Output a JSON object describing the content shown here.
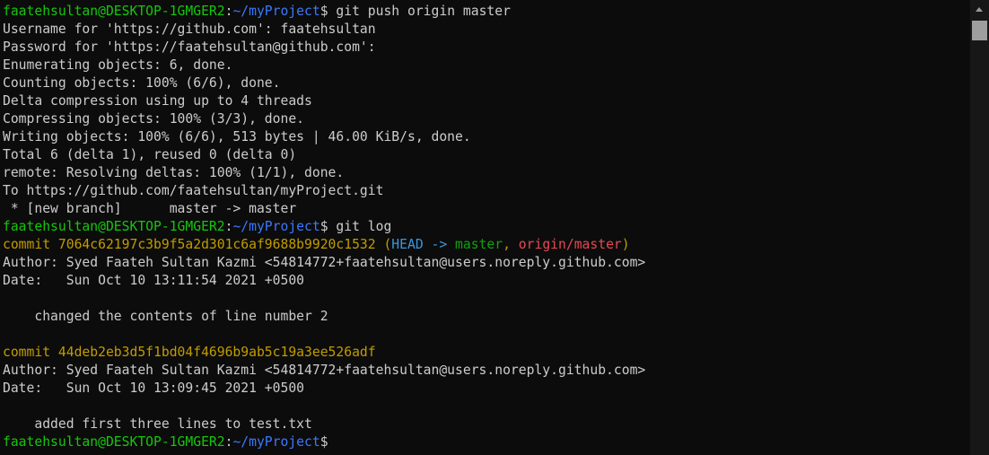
{
  "terminal": {
    "lines": [
      [
        {
          "text": "faatehsultan@DESKTOP-1GMGER2",
          "color": "#16c60c"
        },
        {
          "text": ":",
          "color": "#cccccc"
        },
        {
          "text": "~/myProject",
          "color": "#3b78ff"
        },
        {
          "text": "$ git push origin master",
          "color": "#cccccc"
        }
      ],
      [
        {
          "text": "Username for 'https://github.com': faatehsultan",
          "color": "#cccccc"
        }
      ],
      [
        {
          "text": "Password for 'https://faatehsultan@github.com':",
          "color": "#cccccc"
        }
      ],
      [
        {
          "text": "Enumerating objects: 6, done.",
          "color": "#cccccc"
        }
      ],
      [
        {
          "text": "Counting objects: 100% (6/6), done.",
          "color": "#cccccc"
        }
      ],
      [
        {
          "text": "Delta compression using up to 4 threads",
          "color": "#cccccc"
        }
      ],
      [
        {
          "text": "Compressing objects: 100% (3/3), done.",
          "color": "#cccccc"
        }
      ],
      [
        {
          "text": "Writing objects: 100% (6/6), 513 bytes | 46.00 KiB/s, done.",
          "color": "#cccccc"
        }
      ],
      [
        {
          "text": "Total 6 (delta 1), reused 0 (delta 0)",
          "color": "#cccccc"
        }
      ],
      [
        {
          "text": "remote: Resolving deltas: 100% (1/1), done.",
          "color": "#cccccc"
        }
      ],
      [
        {
          "text": "To https://github.com/faatehsultan/myProject.git",
          "color": "#cccccc"
        }
      ],
      [
        {
          "text": " * [new branch]      master -> master",
          "color": "#cccccc"
        }
      ],
      [
        {
          "text": "faatehsultan@DESKTOP-1GMGER2",
          "color": "#16c60c"
        },
        {
          "text": ":",
          "color": "#cccccc"
        },
        {
          "text": "~/myProject",
          "color": "#3b78ff"
        },
        {
          "text": "$ git log",
          "color": "#cccccc"
        }
      ],
      [
        {
          "text": "commit 7064c62197c3b9f5a2d301c6af9688b9920c1532 ",
          "color": "#c19c00"
        },
        {
          "text": "(",
          "color": "#c19c00"
        },
        {
          "text": "HEAD -> ",
          "color": "#3a96dd"
        },
        {
          "text": "master",
          "color": "#13a10e"
        },
        {
          "text": ", ",
          "color": "#c19c00"
        },
        {
          "text": "origin/master",
          "color": "#e74856"
        },
        {
          "text": ")",
          "color": "#c19c00"
        }
      ],
      [
        {
          "text": "Author: Syed Faateh Sultan Kazmi <54814772+faatehsultan@users.noreply.github.com>",
          "color": "#cccccc"
        }
      ],
      [
        {
          "text": "Date:   Sun Oct 10 13:11:54 2021 +0500",
          "color": "#cccccc"
        }
      ],
      [
        {
          "text": "",
          "color": "#cccccc"
        }
      ],
      [
        {
          "text": "    changed the contents of line number 2",
          "color": "#cccccc"
        }
      ],
      [
        {
          "text": "",
          "color": "#cccccc"
        }
      ],
      [
        {
          "text": "commit 44deb2eb3d5f1bd04f4696b9ab5c19a3ee526adf",
          "color": "#c19c00"
        }
      ],
      [
        {
          "text": "Author: Syed Faateh Sultan Kazmi <54814772+faatehsultan@users.noreply.github.com>",
          "color": "#cccccc"
        }
      ],
      [
        {
          "text": "Date:   Sun Oct 10 13:09:45 2021 +0500",
          "color": "#cccccc"
        }
      ],
      [
        {
          "text": "",
          "color": "#cccccc"
        }
      ],
      [
        {
          "text": "    added first three lines to test.txt",
          "color": "#cccccc"
        }
      ],
      [
        {
          "text": "faatehsultan@DESKTOP-1GMGER2",
          "color": "#16c60c"
        },
        {
          "text": ":",
          "color": "#cccccc"
        },
        {
          "text": "~/myProject",
          "color": "#3b78ff"
        },
        {
          "text": "$",
          "color": "#cccccc"
        }
      ]
    ]
  },
  "scrollbar": {
    "up_icon": "triangle-up-icon"
  },
  "colors": {
    "background": "#0c0c0c",
    "foreground": "#cccccc",
    "prompt_user": "#16c60c",
    "prompt_path": "#3b78ff",
    "commit_hash": "#c19c00",
    "head_ref": "#3a96dd",
    "local_branch": "#13a10e",
    "remote_branch": "#e74856",
    "scrollbar_track": "#171717",
    "scrollbar_thumb": "#9e9e9e"
  }
}
